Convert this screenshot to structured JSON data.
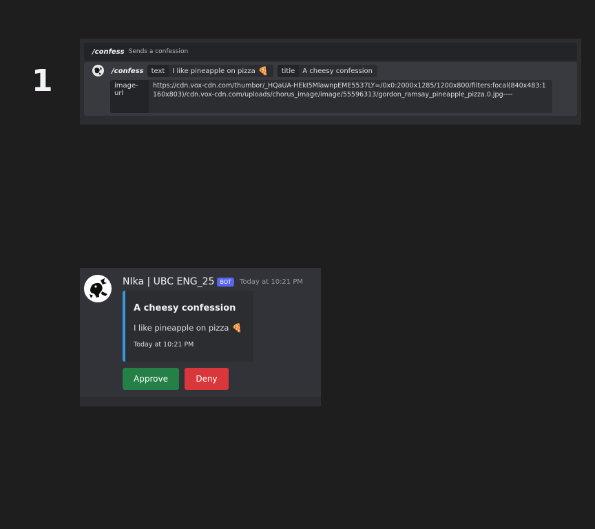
{
  "step": {
    "number": "1"
  },
  "command": {
    "header_name": "/confess",
    "header_desc": "Sends a confession",
    "input_name": "/confess",
    "options": {
      "text": {
        "key": "text",
        "value": "I like pineapple on pizza",
        "emoji": "🍕"
      },
      "title": {
        "key": "title",
        "value": "A cheesy confession"
      },
      "image_url": {
        "key": "image-url",
        "value": "https://cdn.vox-cdn.com/thumbor/_HQaUA-HEkI5MlawnpEME5537LY=/0x0:2000x1285/1200x800/filters:focal(840x483:1160x803)/cdn.vox-cdn.com/uploads/chorus_image/image/55596313/gordon_ramsay_pineapple_pizza.0.jpg----"
      }
    }
  },
  "message": {
    "username": "NIka | UBC ENG_25",
    "badge": "BOT",
    "timestamp": "Today at 10:21 PM",
    "embed": {
      "title": "A cheesy confession",
      "description": "I like pineapple on pizza",
      "emoji": "🍕",
      "footer": "Today at 10:21 PM",
      "accent_color": "#3498db"
    },
    "buttons": {
      "approve": "Approve",
      "deny": "Deny"
    }
  },
  "colors": {
    "background": "#1e1e1f",
    "approve": "#248046",
    "deny": "#da373c",
    "bot_badge": "#5865f2"
  }
}
